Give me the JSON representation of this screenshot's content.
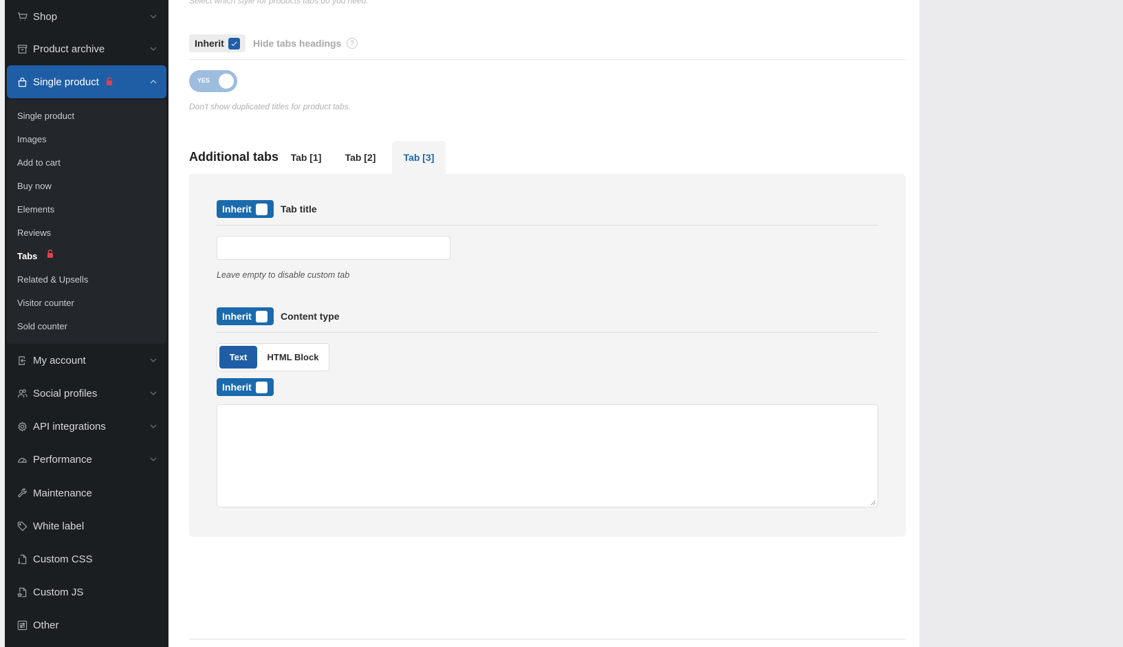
{
  "sidebar": {
    "top_items": [
      {
        "label": "Shop",
        "icon": "cart-icon"
      },
      {
        "label": "Product archive",
        "icon": "archive-icon"
      },
      {
        "label": "Single product",
        "icon": "bag-icon",
        "locked": true,
        "expanded": true
      }
    ],
    "sub_items": [
      {
        "label": "Single product"
      },
      {
        "label": "Images"
      },
      {
        "label": "Add to cart"
      },
      {
        "label": "Buy now"
      },
      {
        "label": "Elements"
      },
      {
        "label": "Reviews"
      },
      {
        "label": "Tabs",
        "current": true,
        "locked": true
      },
      {
        "label": "Related & Upsells"
      },
      {
        "label": "Visitor counter"
      },
      {
        "label": "Sold counter"
      }
    ],
    "bottom_items": [
      {
        "label": "My account",
        "icon": "login-icon",
        "has_children": true
      },
      {
        "label": "Social profiles",
        "icon": "users-icon",
        "has_children": true
      },
      {
        "label": "API integrations",
        "icon": "gear-icon",
        "has_children": true
      },
      {
        "label": "Performance",
        "icon": "gauge-icon",
        "has_children": true
      },
      {
        "label": "Maintenance",
        "icon": "wrench-icon"
      },
      {
        "label": "White label",
        "icon": "tag-icon"
      },
      {
        "label": "Custom CSS",
        "icon": "css-file-icon"
      },
      {
        "label": "Custom JS",
        "icon": "js-file-icon"
      },
      {
        "label": "Other",
        "icon": "sliders-icon"
      }
    ],
    "colors": {
      "active_bg": "#1f5ea5",
      "lock": "#e0414f"
    }
  },
  "main": {
    "top_description": "Select which style for products tabs do you need.",
    "hide_headings": {
      "inherit_label": "Inherit",
      "inherit_checked": true,
      "label": "Hide tabs headings",
      "help": "?",
      "toggle_label": "YES",
      "toggle_on": true,
      "description": "Don't show duplicated titles for product tabs."
    },
    "additional_tabs": {
      "title": "Additional tabs",
      "tabs": [
        {
          "label": "Tab [1]"
        },
        {
          "label": "Tab [2]"
        },
        {
          "label": "Tab [3]",
          "active": true
        }
      ],
      "tab_title": {
        "inherit_label": "Inherit",
        "inherit_checked": false,
        "label": "Tab title",
        "value": "",
        "hint": "Leave empty to disable custom tab"
      },
      "content_type": {
        "inherit_label": "Inherit",
        "inherit_checked": false,
        "label": "Content type",
        "options": [
          "Text",
          "HTML Block"
        ],
        "selected": "Text"
      },
      "content": {
        "inherit_label": "Inherit",
        "inherit_checked": false,
        "value": ""
      }
    },
    "accent_color": "#1a6aad"
  }
}
